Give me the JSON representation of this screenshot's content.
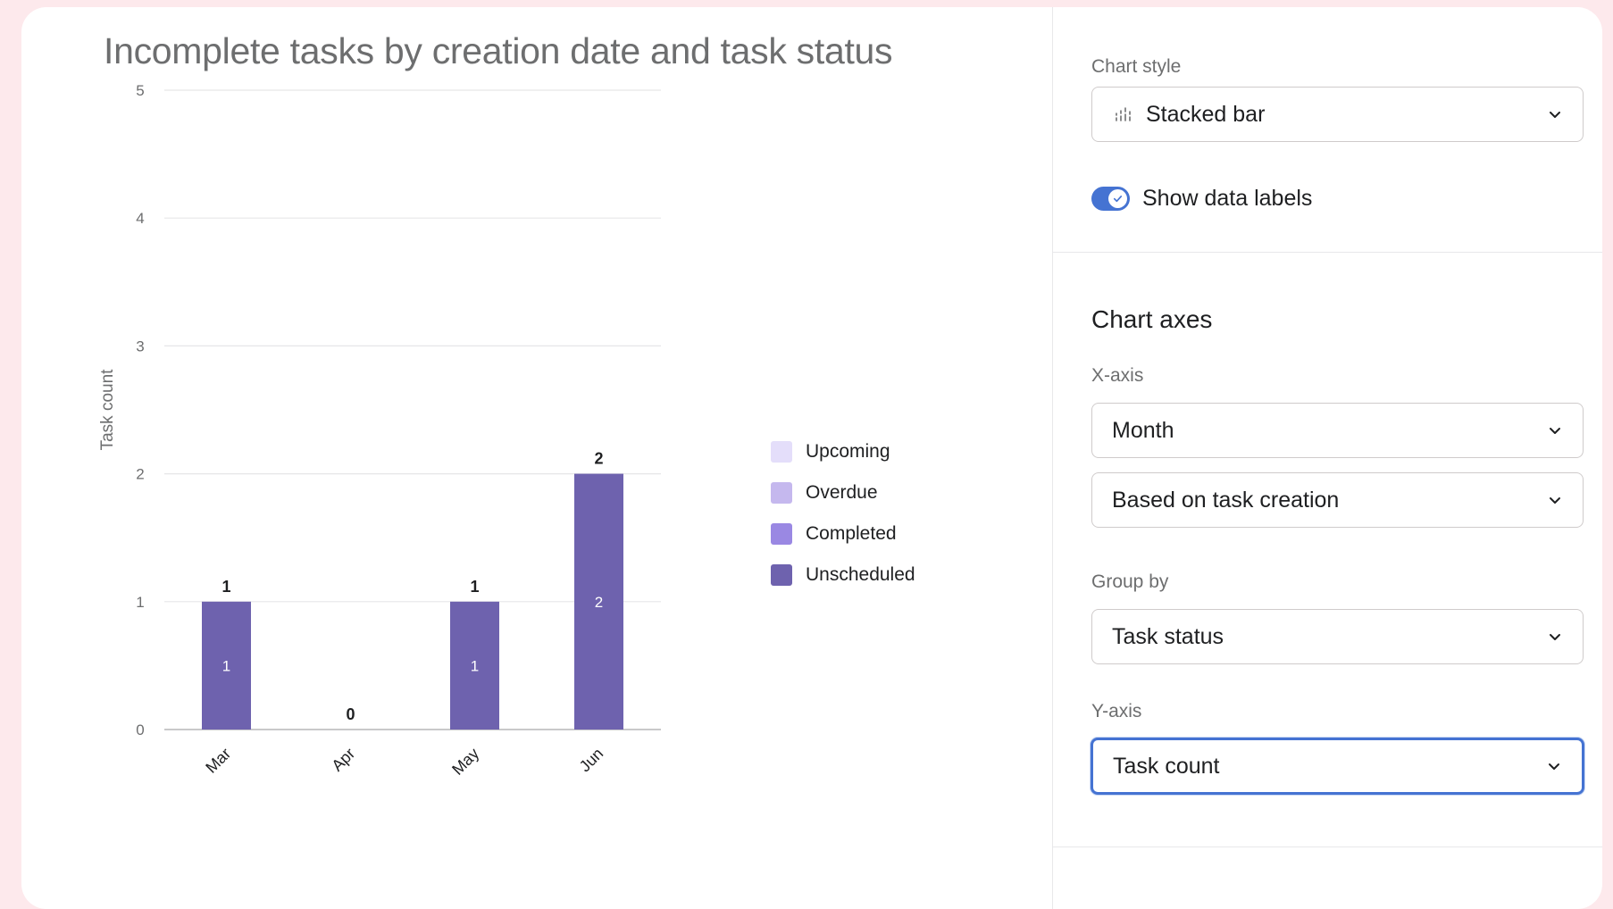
{
  "chart": {
    "title": "Incomplete tasks by creation date and task status"
  },
  "chart_data": {
    "type": "bar",
    "stacked": true,
    "title": "Incomplete tasks by creation date and task status",
    "xlabel": "",
    "ylabel": "Task count",
    "categories": [
      "Mar",
      "Apr",
      "May",
      "Jun"
    ],
    "ylim": [
      0,
      5
    ],
    "yticks": [
      0,
      1,
      2,
      3,
      4,
      5
    ],
    "grid": true,
    "legend_position": "right",
    "series": [
      {
        "name": "Upcoming",
        "color": "#e4defa",
        "values": [
          0,
          0,
          0,
          0
        ]
      },
      {
        "name": "Overdue",
        "color": "#c5b8ee",
        "values": [
          0,
          0,
          0,
          0
        ]
      },
      {
        "name": "Completed",
        "color": "#9a88e3",
        "values": [
          0,
          0,
          0,
          0
        ]
      },
      {
        "name": "Unscheduled",
        "color": "#6e62ae",
        "values": [
          1,
          0,
          1,
          2
        ]
      }
    ],
    "totals": [
      1,
      0,
      1,
      2
    ],
    "data_labels": true
  },
  "settings": {
    "chart_style_label": "Chart style",
    "chart_style_value": "Stacked bar",
    "chart_style_icon": "stacked-bar-icon",
    "show_labels_text": "Show data labels",
    "show_labels_on": true,
    "axes_heading": "Chart axes",
    "x_axis_label": "X-axis",
    "x_axis_value": "Month",
    "x_axis_basis": "Based on task creation",
    "group_by_label": "Group by",
    "group_by_value": "Task status",
    "y_axis_label": "Y-axis",
    "y_axis_value": "Task count"
  },
  "colors": {
    "accent": "#4573d2",
    "bar": "#6e62ae"
  }
}
